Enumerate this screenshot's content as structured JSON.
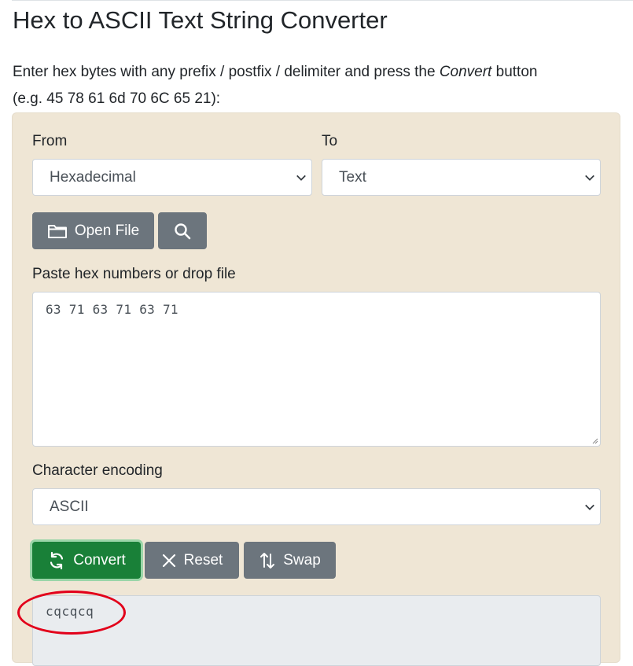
{
  "page": {
    "title": "Hex to ASCII Text String Converter",
    "intro_before": "Enter hex bytes with any prefix / postfix / delimiter and press the ",
    "intro_emph": "Convert",
    "intro_after": " button",
    "intro_example": "(e.g. 45 78 61 6d 70 6C 65 21):"
  },
  "form": {
    "from_label": "From",
    "from_value": "Hexadecimal",
    "to_label": "To",
    "to_value": "Text",
    "open_file_label": "Open File",
    "input_label": "Paste hex numbers or drop file",
    "input_value": "63 71 63 71 63 71",
    "encoding_label": "Character encoding",
    "encoding_value": "ASCII",
    "convert_label": "Convert",
    "reset_label": "Reset",
    "swap_label": "Swap",
    "output_value": "cqcqcq"
  },
  "colors": {
    "panel_bg": "#efe6d5",
    "convert_green": "#198038",
    "gray_button": "#6c757d",
    "annotation_red": "#e2001a"
  },
  "icons": [
    "folder-icon",
    "search-icon",
    "refresh-icon",
    "close-icon",
    "swap-icon",
    "chevron-down-icon"
  ]
}
